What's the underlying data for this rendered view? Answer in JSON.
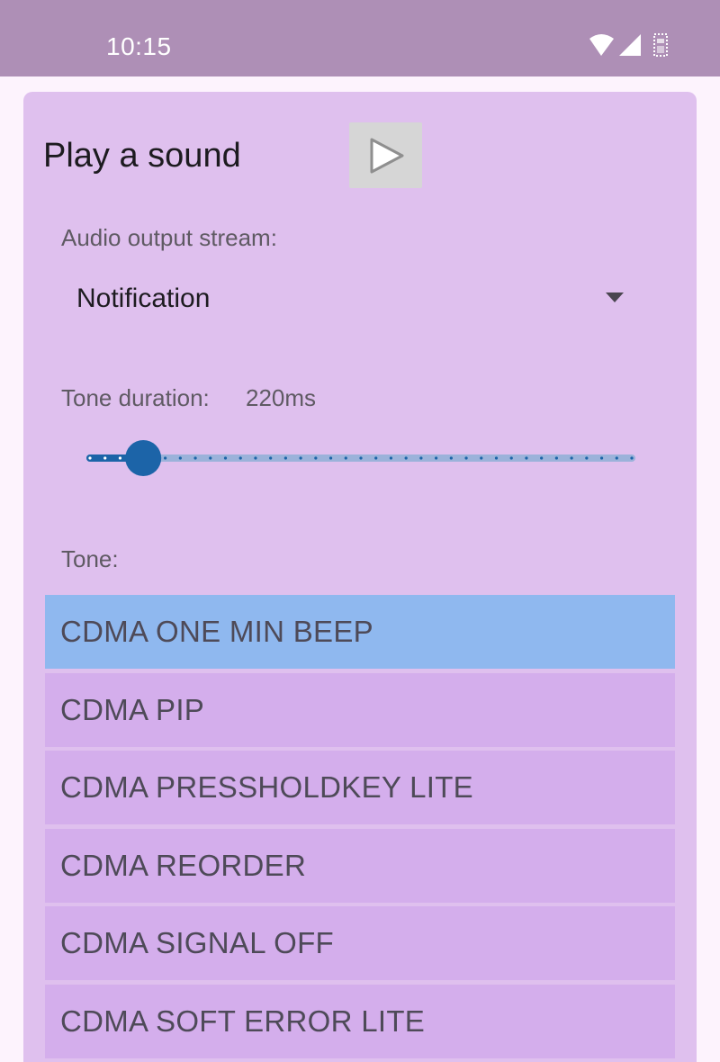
{
  "status_bar": {
    "time": "10:15",
    "icons": [
      "wifi-icon",
      "cell-signal-icon",
      "sim-icon"
    ]
  },
  "header": {
    "title": "Play a sound",
    "play_icon": "play-icon"
  },
  "stream": {
    "label": "Audio output stream:",
    "selected": "Notification",
    "caret_icon": "dropdown-caret-icon"
  },
  "duration": {
    "label": "Tone duration:",
    "value": "220ms",
    "slider_fraction": 0.095
  },
  "tone": {
    "label": "Tone:",
    "items": [
      {
        "label": "CDMA ONE MIN BEEP",
        "selected": true
      },
      {
        "label": "CDMA PIP",
        "selected": false
      },
      {
        "label": "CDMA PRESSHOLDKEY LITE",
        "selected": false
      },
      {
        "label": "CDMA REORDER",
        "selected": false
      },
      {
        "label": "CDMA SIGNAL OFF",
        "selected": false
      },
      {
        "label": "CDMA SOFT ERROR LITE",
        "selected": false
      }
    ]
  },
  "colors": {
    "status_bar": "#ae8fb6",
    "card": "#dfc0ee",
    "list_item": "#d4aeec",
    "list_item_selected": "#8fb8ef",
    "slider_thumb": "#1c64a8"
  }
}
